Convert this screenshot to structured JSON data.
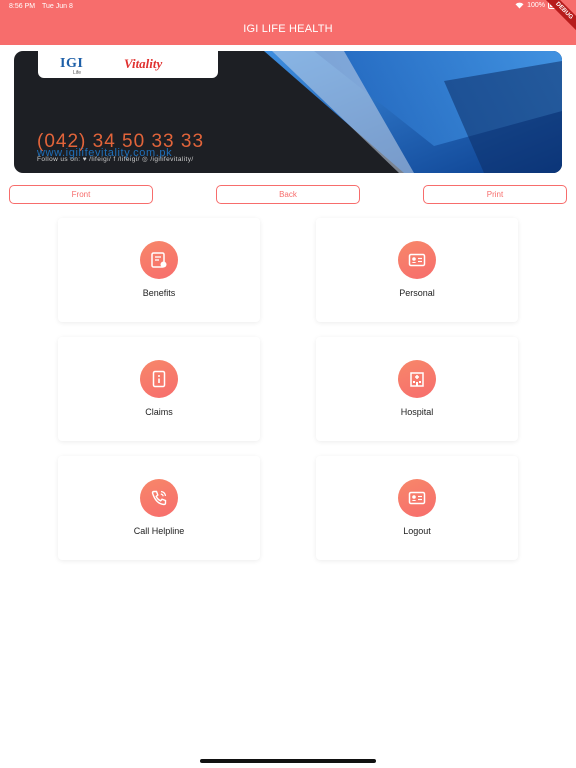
{
  "status_bar": {
    "time": "8:56 PM",
    "date": "Tue Jun 8",
    "battery": "100%"
  },
  "header": {
    "title": "IGI LIFE HEALTH",
    "debug_label": "DEBUG"
  },
  "card": {
    "logo_igi": "IGI",
    "logo_life": "Life",
    "logo_vitality": "Vitality",
    "phone": "(042) 34 50 33 33",
    "website": "www.igilifevitality.com.pk",
    "follow": "Follow us on:  ♥ /lifeigi/   f /lifeigi/   ◎ /igilifevitality/"
  },
  "actions": {
    "front": "Front",
    "back": "Back",
    "print": "Print"
  },
  "menu": [
    {
      "label": "Benefits",
      "icon": "benefits-card-icon"
    },
    {
      "label": "Personal",
      "icon": "id-card-icon"
    },
    {
      "label": "Claims",
      "icon": "info-document-icon"
    },
    {
      "label": "Hospital",
      "icon": "hospital-icon"
    },
    {
      "label": "Call Helpline",
      "icon": "phone-icon"
    },
    {
      "label": "Logout",
      "icon": "id-card-icon"
    }
  ],
  "colors": {
    "brand": "#f76d6c",
    "accent": "#1f6fb9"
  }
}
